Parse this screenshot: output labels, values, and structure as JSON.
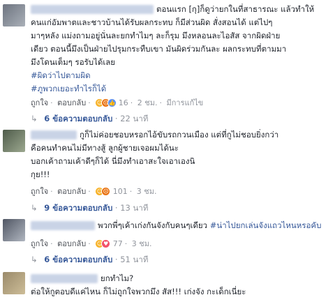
{
  "comments": [
    {
      "lines": [
        "ตอนแรก [กุ]ก็ดูว่ายกในที่สาธารณะ แล้วทำให้",
        "คนแก่อัมพาตและชาวบ้านได้รับผลกระทบ ก็มีส่วนผิด สั่งสอนได้ แต่ไปๆ",
        "มาๆหลัง แม่งถามอยู่นั่นละยกทำไมๆ ละก็รุม มึงหลอนละไอสัส จากผิดฝ่าย",
        "เดียว ตอนนี้มึงเป็นฝ่ายไปรุมกระทืบเขา มันผิดร่วมกันละ ผลกระทบที่ตามมา",
        "มึงโดนเต็มๆ รอรับได้เลย"
      ],
      "hashtags": [
        "#ผิดว่าไปตามผิด",
        "#ภูพวกเยอะทำไรก็ได้"
      ],
      "actions": {
        "like": "ถูกใจ",
        "reply": "ตอบกลับ",
        "count": "16",
        "time": "2 ชม.",
        "edited": "มีการแก้ไข"
      },
      "replies": {
        "label": "6 ข้อความตอบกลับ",
        "time": "22 นาที"
      }
    },
    {
      "lines": [
        "กูก็ไม่ค่อยชอบหรอกไอ้ขับรถกวนเมือง แต่ที่กูไม่ชอบยิ่งกว่า",
        "คือคนทำคนไม่มีทางสู้ ลูกผู้ชายเจอผมได้นะ",
        "บอกเค้าถามเค้าดีๆก็ได้ นี่มึงทำเอาสะใจเอาเองนิ",
        "กุย!!!"
      ],
      "actions": {
        "like": "ถูกใจ",
        "reply": "ตอบกลับ",
        "count": "101",
        "time": "3 ชม."
      },
      "replies": {
        "label": "9 ข้อความตอบกลับ",
        "time": "13 นาที"
      }
    },
    {
      "text": "พวกพี่ๆเค้าเก่งกันจังกับคนๆเดียว",
      "hashtag": "#น่าไปยกเล่นจังแถวไหนหรอคับ",
      "actions": {
        "like": "ถูกใจ",
        "reply": "ตอบกลับ",
        "count": "77",
        "time": "3 ชม."
      },
      "replies": {
        "label": "6 ข้อความตอบกลับ",
        "time": "51 นาที"
      }
    },
    {
      "first": "ยกทำไม?",
      "second": "ต่อให้กูตอบดีแค่ไหน ก็ไม่ถูกใจพวกมึง สัส!!! เก่งจัง กะเด็กเนี่ยะ"
    }
  ],
  "icons": {
    "reply_arrow": "reply-arrow-icon",
    "haha": "haha-react-icon",
    "angry": "angry-react-icon",
    "like": "like-react-icon",
    "love": "love-react-icon"
  },
  "colors": {
    "link": "#365899",
    "meta": "#90949c",
    "text": "#1d2129"
  }
}
